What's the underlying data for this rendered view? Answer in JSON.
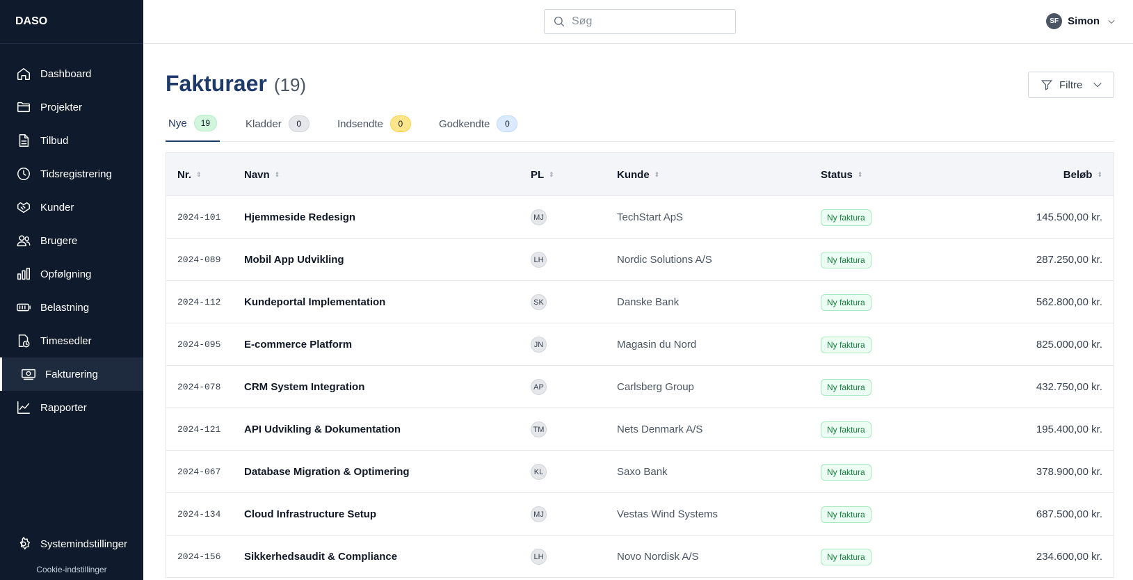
{
  "app": {
    "brand": "DASO"
  },
  "sidebar": {
    "items": [
      {
        "label": "Dashboard",
        "icon": "home-icon"
      },
      {
        "label": "Projekter",
        "icon": "folder-icon"
      },
      {
        "label": "Tilbud",
        "icon": "document-icon"
      },
      {
        "label": "Tidsregistrering",
        "icon": "clock-icon"
      },
      {
        "label": "Kunder",
        "icon": "handshake-icon"
      },
      {
        "label": "Brugere",
        "icon": "users-icon"
      },
      {
        "label": "Opfølgning",
        "icon": "bar-chart-icon"
      },
      {
        "label": "Belastning",
        "icon": "battery-icon"
      },
      {
        "label": "Timesedler",
        "icon": "timesheet-icon"
      },
      {
        "label": "Fakturering",
        "icon": "banknote-icon",
        "active": true
      },
      {
        "label": "Rapporter",
        "icon": "line-chart-icon"
      }
    ],
    "settings_label": "Systemindstillinger",
    "cookie_label": "Cookie-indstillinger"
  },
  "topbar": {
    "search_placeholder": "Søg",
    "user_initials": "SF",
    "user_name": "Simon"
  },
  "page": {
    "title": "Fakturaer",
    "count": "(19)",
    "filter_label": "Filtre"
  },
  "tabs": [
    {
      "label": "Nye",
      "count": "19",
      "color": "#d1f5dd"
    },
    {
      "label": "Kladder",
      "count": "0",
      "color": "#e5e7eb"
    },
    {
      "label": "Indsendte",
      "count": "0",
      "color": "#fde68a"
    },
    {
      "label": "Godkendte",
      "count": "0",
      "color": "#dbeafe"
    }
  ],
  "table": {
    "columns": [
      "Nr.",
      "Navn",
      "PL",
      "Kunde",
      "Status",
      "Beløb"
    ],
    "rows": [
      {
        "nr": "2024-101",
        "navn": "Hjemmeside Redesign",
        "pl": "MJ",
        "kunde": "TechStart ApS",
        "status": "Ny faktura",
        "belob": "145.500,00 kr."
      },
      {
        "nr": "2024-089",
        "navn": "Mobil App Udvikling",
        "pl": "LH",
        "kunde": "Nordic Solutions A/S",
        "status": "Ny faktura",
        "belob": "287.250,00 kr."
      },
      {
        "nr": "2024-112",
        "navn": "Kundeportal Implementation",
        "pl": "SK",
        "kunde": "Danske Bank",
        "status": "Ny faktura",
        "belob": "562.800,00 kr."
      },
      {
        "nr": "2024-095",
        "navn": "E-commerce Platform",
        "pl": "JN",
        "kunde": "Magasin du Nord",
        "status": "Ny faktura",
        "belob": "825.000,00 kr."
      },
      {
        "nr": "2024-078",
        "navn": "CRM System Integration",
        "pl": "AP",
        "kunde": "Carlsberg Group",
        "status": "Ny faktura",
        "belob": "432.750,00 kr."
      },
      {
        "nr": "2024-121",
        "navn": "API Udvikling & Dokumentation",
        "pl": "TM",
        "kunde": "Nets Denmark A/S",
        "status": "Ny faktura",
        "belob": "195.400,00 kr."
      },
      {
        "nr": "2024-067",
        "navn": "Database Migration & Optimering",
        "pl": "KL",
        "kunde": "Saxo Bank",
        "status": "Ny faktura",
        "belob": "378.900,00 kr."
      },
      {
        "nr": "2024-134",
        "navn": "Cloud Infrastructure Setup",
        "pl": "MJ",
        "kunde": "Vestas Wind Systems",
        "status": "Ny faktura",
        "belob": "687.500,00 kr."
      },
      {
        "nr": "2024-156",
        "navn": "Sikkerhedsaudit & Compliance",
        "pl": "LH",
        "kunde": "Novo Nordisk A/S",
        "status": "Ny faktura",
        "belob": "234.600,00 kr."
      }
    ]
  }
}
